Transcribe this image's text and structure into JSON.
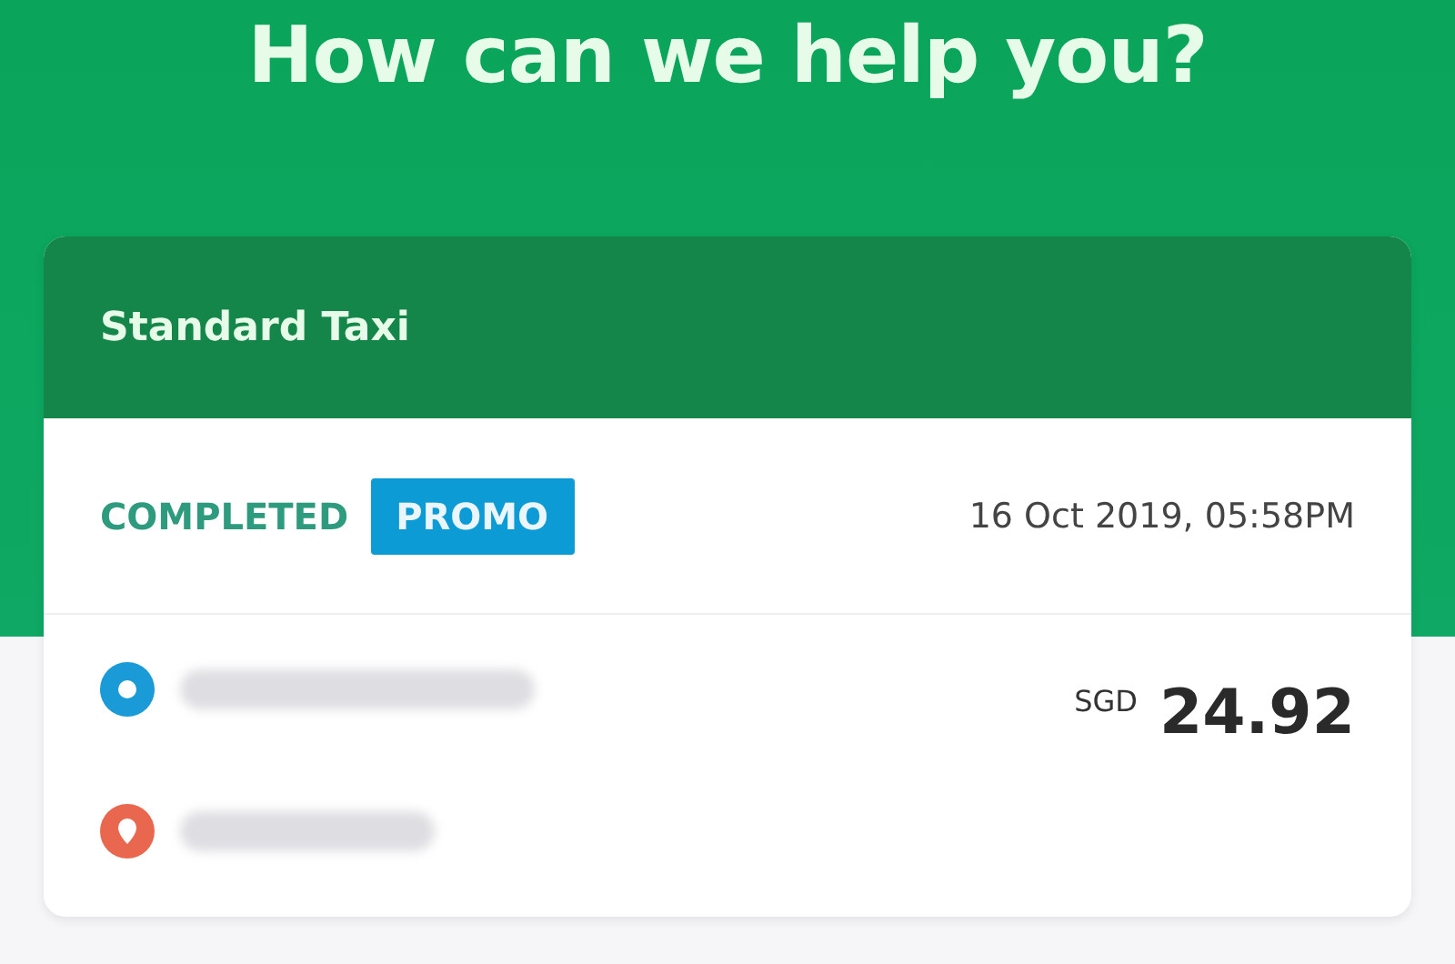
{
  "heading": "How can we help you?",
  "ride": {
    "service": "Standard Taxi",
    "status": "COMPLETED",
    "badge": "PROMO",
    "datetime": "16 Oct 2019, 05:58PM",
    "currency": "SGD",
    "amount": "24.92",
    "stops": [
      {
        "kind": "pickup"
      },
      {
        "kind": "dropoff"
      }
    ]
  }
}
